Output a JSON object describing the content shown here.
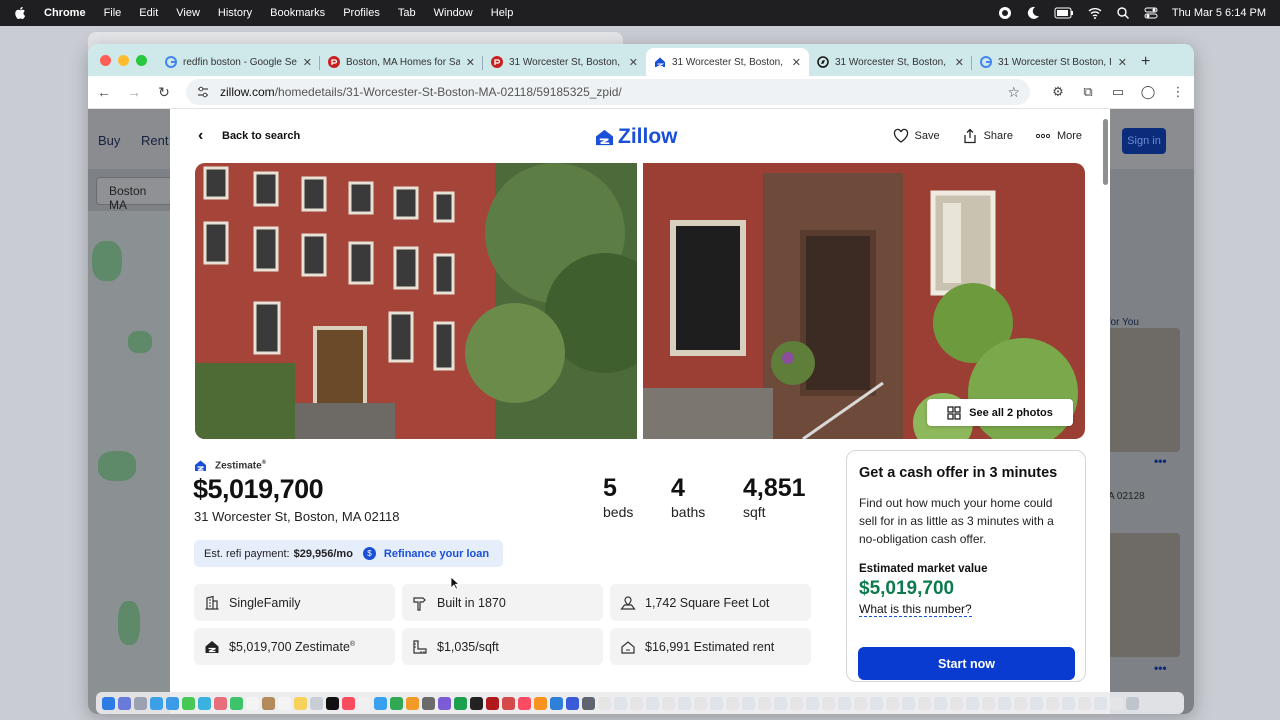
{
  "menubar": {
    "app": "Chrome",
    "items": [
      "File",
      "Edit",
      "View",
      "History",
      "Bookmarks",
      "Profiles",
      "Tab",
      "Window",
      "Help"
    ],
    "clock": "Thu Mar 5  6:14 PM"
  },
  "tabs": [
    {
      "title": "redfin boston - Google Se",
      "icon": "google-icon"
    },
    {
      "title": "Boston, MA Homes for Sa",
      "icon": "redfin-icon"
    },
    {
      "title": "31 Worcester St, Boston,",
      "icon": "redfin-icon"
    },
    {
      "title": "31 Worcester St, Boston,",
      "icon": "zillow-icon",
      "active": true
    },
    {
      "title": "31 Worcester St, Boston,",
      "icon": "compass-icon"
    },
    {
      "title": "31 Worcester St Boston, I",
      "icon": "google-icon"
    }
  ],
  "address_bar": {
    "host": "zillow.com",
    "path": "/homedetails/31-Worcester-St-Boston-MA-02118/59185325_zpid/"
  },
  "behind": {
    "nav": [
      "Buy",
      "Rent"
    ],
    "signin": "Sign in",
    "search": "Boston MA",
    "for_you": "s for You",
    "card_zip": "A 02128",
    "card_zip2": "28"
  },
  "modal": {
    "back_label": "Back to search",
    "logo": "Zillow",
    "actions": {
      "save": "Save",
      "share": "Share",
      "more": "More"
    },
    "see_all": "See all 2 photos",
    "zestimate_label": "Zestimate",
    "zestimate_reg": "®",
    "price": "$5,019,700",
    "address": "31 Worcester St, Boston, MA 02118",
    "stats": [
      {
        "num": "5",
        "label": "beds"
      },
      {
        "num": "4",
        "label": "baths"
      },
      {
        "num": "4,851",
        "label": "sqft"
      }
    ],
    "refi": {
      "label": "Est. refi payment:",
      "value": "$29,956/mo",
      "link": "Refinance your loan"
    },
    "facts": [
      {
        "text": "SingleFamily",
        "icon": "building-icon"
      },
      {
        "text": "Built in 1870",
        "icon": "hammer-icon"
      },
      {
        "text": "1,742 Square Feet Lot",
        "icon": "lot-icon"
      },
      {
        "text": "$5,019,700 Zestimate",
        "icon": "zillow-z-icon"
      },
      {
        "text": "$1,035/sqft",
        "icon": "ruler-icon"
      },
      {
        "text": "$16,991 Estimated rent",
        "icon": "rent-icon"
      }
    ],
    "cash_offer": {
      "title": "Get a cash offer in 3 minutes",
      "body": "Find out how much your home could sell for in as little as 3 minutes with a no-obligation cash offer.",
      "emv_label": "Estimated market value",
      "emv_value": "$5,019,700",
      "what_link": "What is this number?",
      "button": "Start now"
    }
  },
  "colors": {
    "zillow_blue": "#1a4fd8",
    "button_blue": "#0a3bd1",
    "value_green": "#0d7a4d",
    "tabstrip": "#cfe8e9"
  }
}
